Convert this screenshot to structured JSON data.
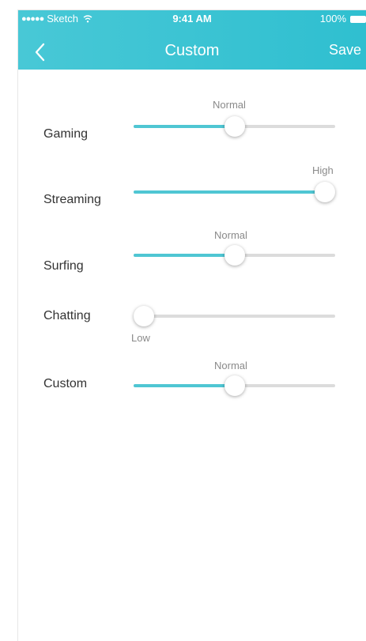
{
  "status_bar": {
    "carrier": "Sketch",
    "time": "9:41 AM",
    "battery": "100%"
  },
  "nav": {
    "title": "Custom",
    "save_label": "Save"
  },
  "rows": [
    {
      "label": "Gaming",
      "level": "Normal",
      "value": 0.5
    },
    {
      "label": "Streaming",
      "level": "High",
      "value": 0.95
    },
    {
      "label": "Surfing",
      "level": "Normal",
      "value": 0.5
    },
    {
      "label": "Chatting",
      "level": "Low",
      "value": 0.05
    },
    {
      "label": "Custom",
      "level": "Normal",
      "value": 0.5
    }
  ],
  "colors": {
    "header": "#3ac3d3",
    "accent": "#4fc6d3",
    "track": "#dcdcdc"
  }
}
